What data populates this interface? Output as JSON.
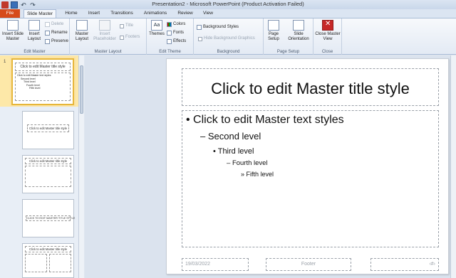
{
  "window": {
    "title": "Presentation2 - Microsoft PowerPoint (Product Activation Failed)"
  },
  "tabs": [
    "File",
    "Slide Master",
    "Home",
    "Insert",
    "Transitions",
    "Animations",
    "Review",
    "View"
  ],
  "ribbon": {
    "edit_master": {
      "caption": "Edit Master",
      "insert_slide_master": "Insert Slide Master",
      "insert_layout": "Insert Layout",
      "delete": "Delete",
      "rename": "Rename",
      "preserve": "Preserve"
    },
    "master_layout": {
      "caption": "Master Layout",
      "master_layout": "Master Layout",
      "insert_placeholder": "Insert Placeholder",
      "title": "Title",
      "footers": "Footers"
    },
    "edit_theme": {
      "caption": "Edit Theme",
      "themes": "Themes",
      "colors": "Colors",
      "fonts": "Fonts",
      "effects": "Effects"
    },
    "background": {
      "caption": "Background",
      "background_styles": "Background Styles",
      "hide_background_graphics": "Hide Background Graphics"
    },
    "page_setup": {
      "caption": "Page Setup",
      "page_setup": "Page Setup",
      "slide_orientation": "Slide Orientation"
    },
    "close": {
      "caption": "Close",
      "close_master_view": "Close Master View"
    }
  },
  "thumbnails": {
    "selected_number": "1",
    "master_title": "Click to edit Master title style",
    "thumb_lines": [
      "Click to edit Master text styles",
      "Second level",
      "Third level",
      "Fourth level",
      "Fifth level"
    ],
    "thumb2_title": "Click to edit Master title style",
    "thumb3_title": "Click to edit Master title style",
    "thumb4_title": "CLICK TO EDIT MASTER TITLE STYLE",
    "thumb5_title": "Click to edit Master title style"
  },
  "slide": {
    "title": "Click to edit Master title style",
    "levels": [
      "Click to edit Master text styles",
      "Second level",
      "Third level",
      "Fourth level",
      "Fifth level"
    ],
    "date": "19/03/2022",
    "footer": "Footer",
    "number": "‹#›"
  }
}
